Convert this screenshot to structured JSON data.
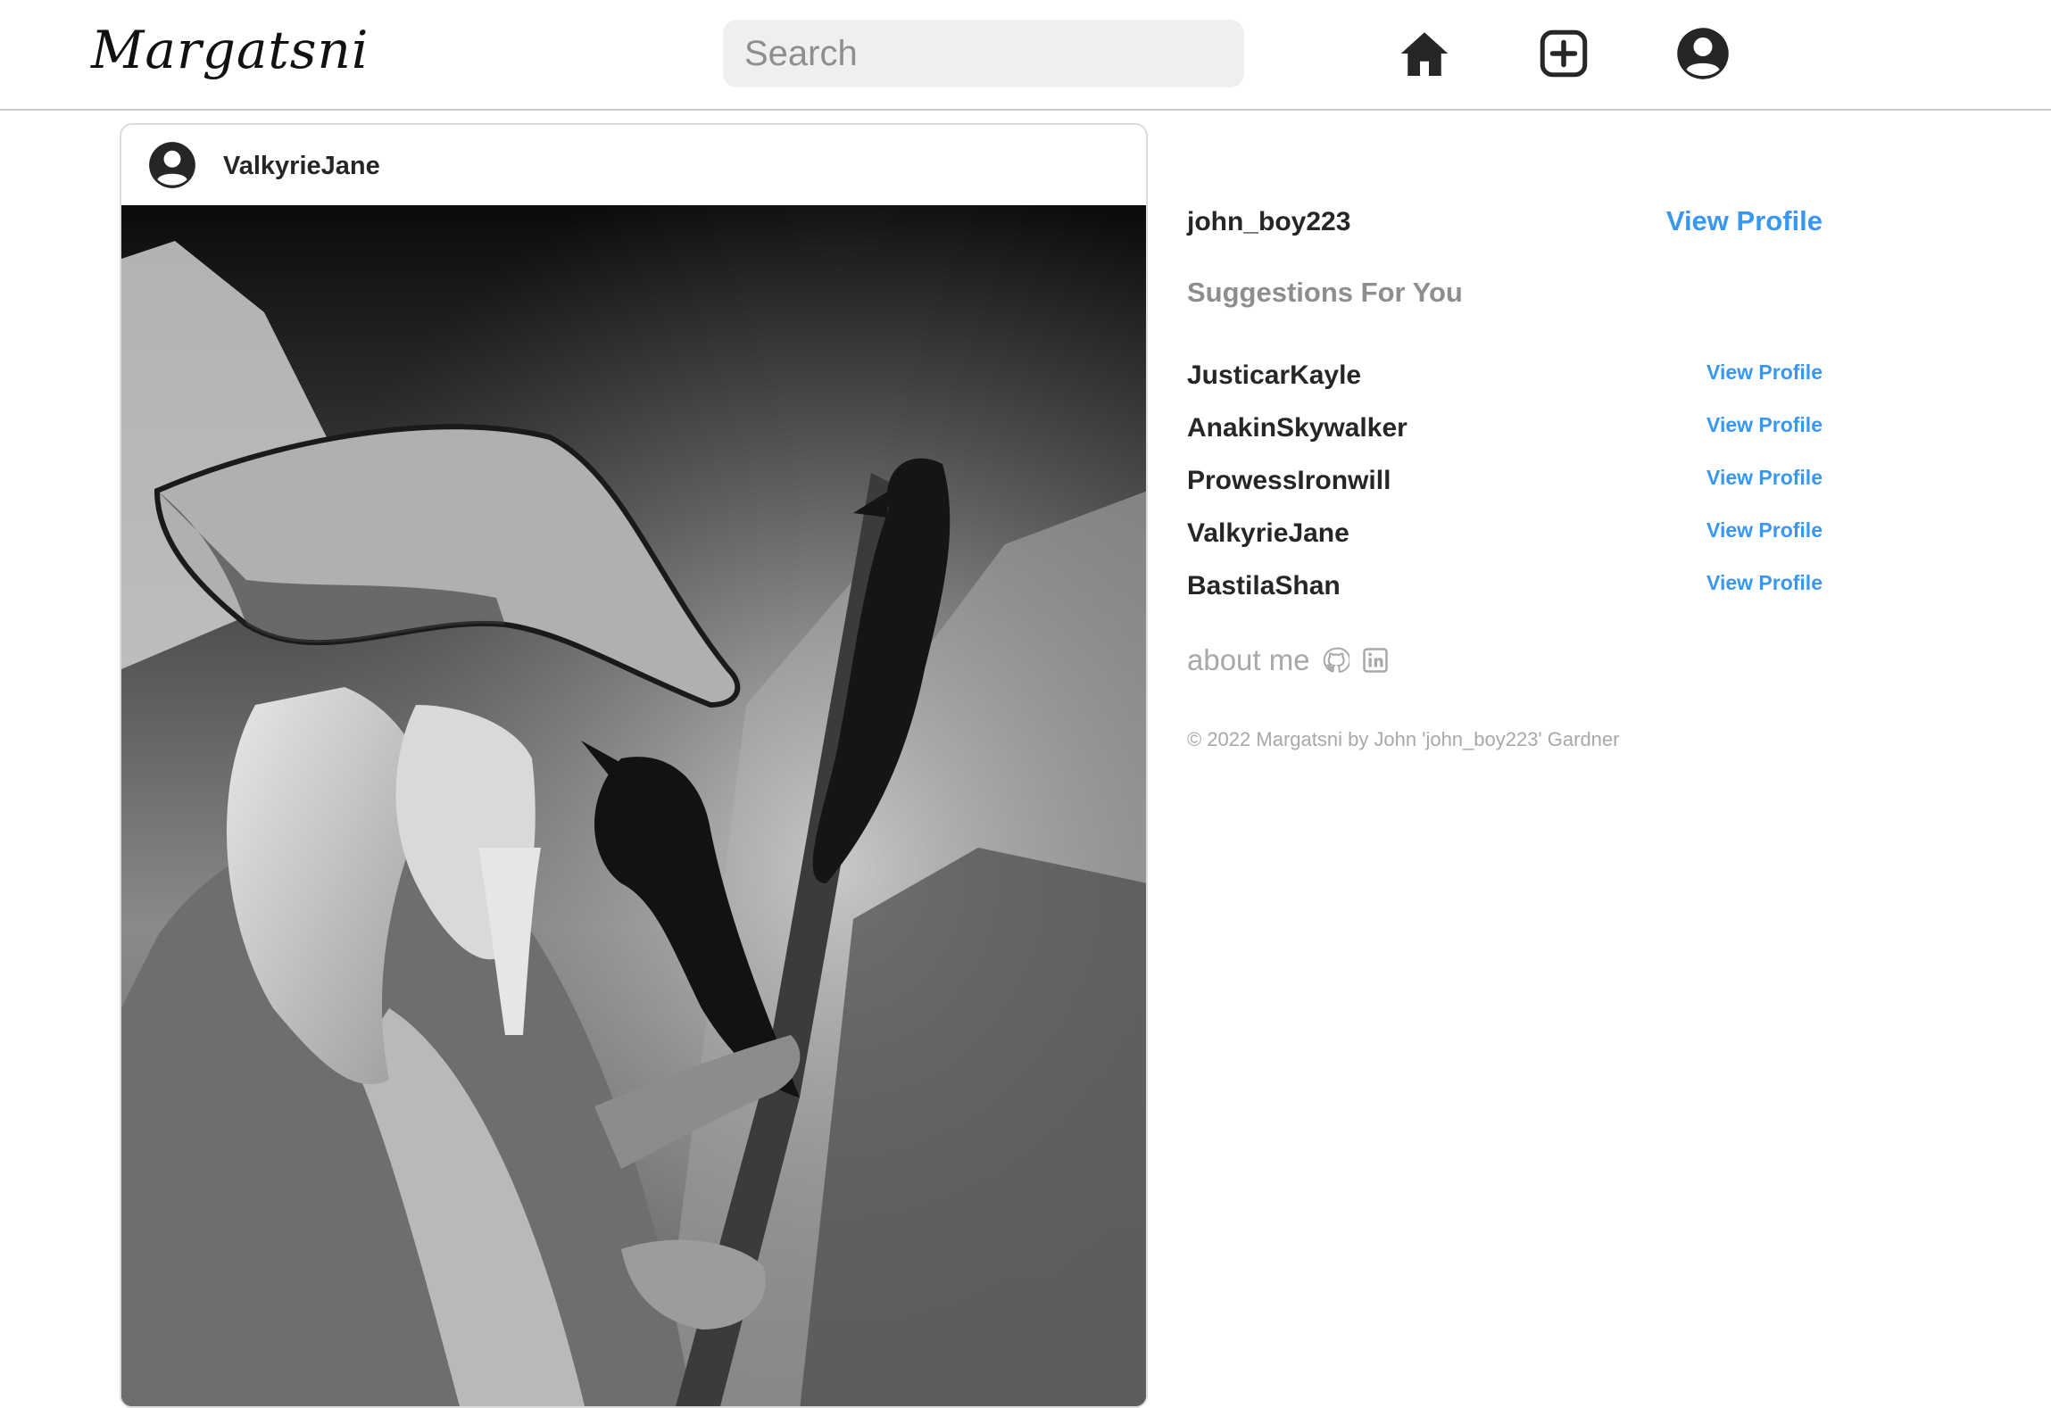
{
  "app": {
    "logo_text": "Margatsni",
    "search": {
      "placeholder": "Search",
      "value": ""
    },
    "nav_icons": [
      "home-icon",
      "new-post-icon",
      "profile-icon"
    ]
  },
  "post": {
    "username": "ValkyrieJane",
    "avatar_icon": "user-circle-icon",
    "image_alt": "Ink painting of a bearded wanderer in a wide-brimmed hat holding a staff with two ravens"
  },
  "sidebar": {
    "current_user": {
      "name": "john_boy223",
      "link_label": "View Profile"
    },
    "suggestions_title": "Suggestions For You",
    "suggestions": [
      {
        "name": "JusticarKayle",
        "link_label": "View Profile"
      },
      {
        "name": "AnakinSkywalker",
        "link_label": "View Profile"
      },
      {
        "name": "ProwessIronwill",
        "link_label": "View Profile"
      },
      {
        "name": "ValkyrieJane",
        "link_label": "View Profile"
      },
      {
        "name": "BastilaShan",
        "link_label": "View Profile"
      }
    ],
    "about_label": "about me",
    "about_icons": [
      "github-icon",
      "linkedin-icon"
    ],
    "copyright": "© 2022 Margatsni by John 'john_boy223' Gardner"
  },
  "colors": {
    "link": "#3897f0",
    "muted": "#8e8e8e",
    "text": "#262626",
    "border": "#dbdbdb",
    "search_bg": "#efefef"
  }
}
